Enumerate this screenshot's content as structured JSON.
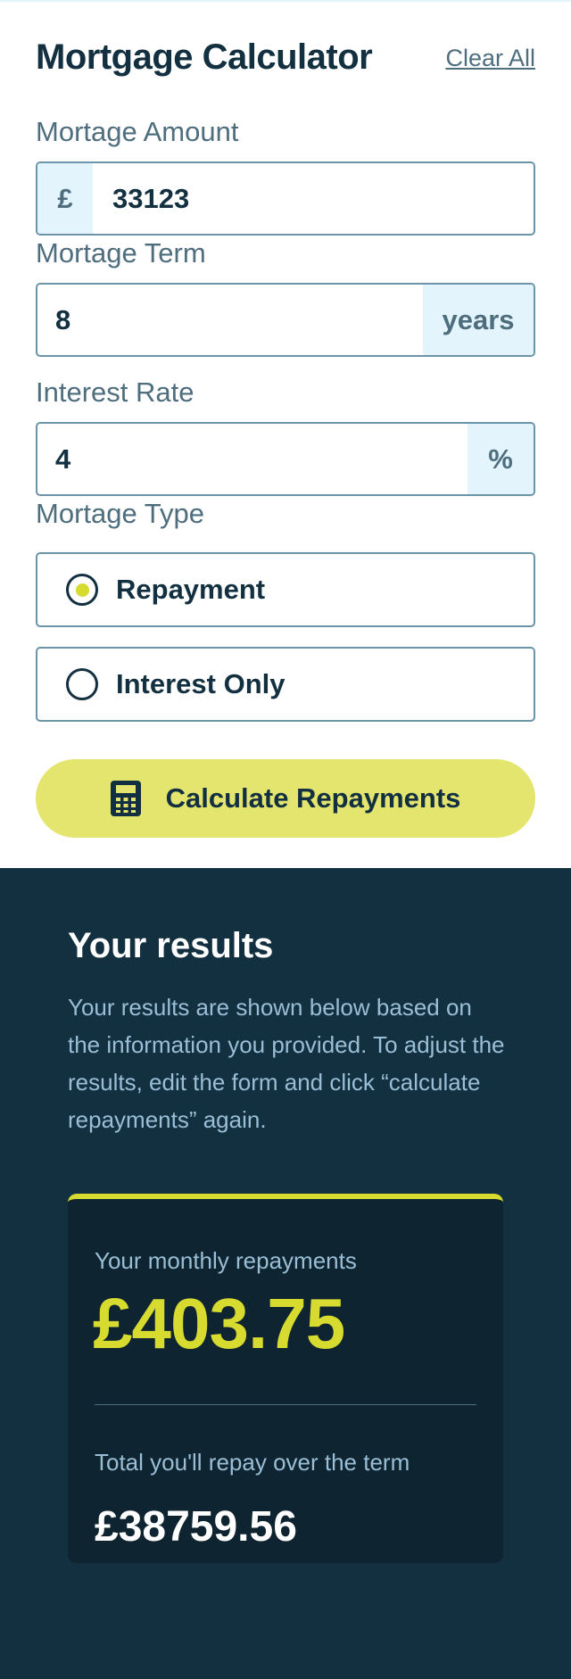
{
  "header": {
    "title": "Mortgage Calculator",
    "clear_label": "Clear All"
  },
  "amount": {
    "label": "Mortage Amount",
    "prefix": "£",
    "value": "33123"
  },
  "term": {
    "label": "Mortage Term",
    "value": "8",
    "suffix": "years"
  },
  "rate": {
    "label": "Interest Rate",
    "value": "4",
    "suffix": "%"
  },
  "type": {
    "label": "Mortage Type",
    "options": [
      {
        "label": "Repayment",
        "selected": true
      },
      {
        "label": "Interest Only",
        "selected": false
      }
    ]
  },
  "calculate": {
    "label": "Calculate Repayments",
    "icon": "calculator-icon"
  },
  "results": {
    "title": "Your results",
    "description": "Your results are shown below based on the information you provided. To adjust the results, edit the form and click “calculate repayments” again.",
    "monthly_label": "Your monthly repayments",
    "monthly_value": "£403.75",
    "total_label": "Total you'll repay over the term",
    "total_value": "£38759.56"
  },
  "colors": {
    "accent": "#d8db2f",
    "button": "#e3e56e",
    "dark": "#133041",
    "card": "#0e2431",
    "muted": "#4e6e7e",
    "input_border": "#6b94a8",
    "affix_bg": "#e3f4fc"
  }
}
